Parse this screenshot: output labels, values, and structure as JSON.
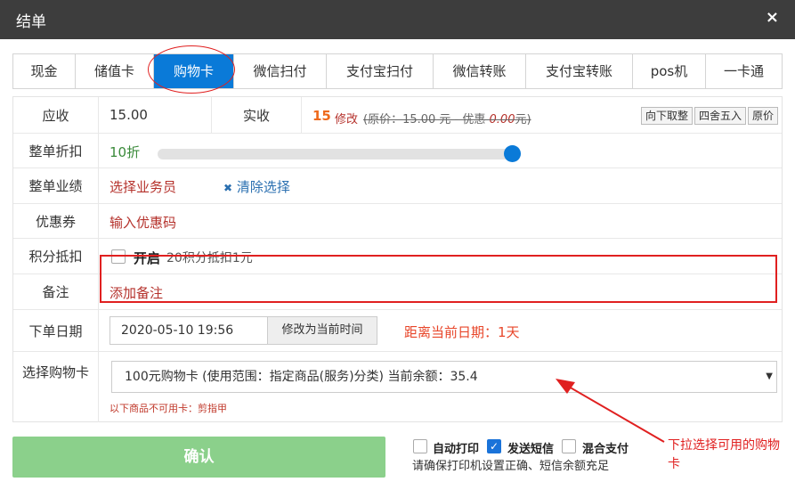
{
  "dialog": {
    "title": "结单",
    "close_icon": "×"
  },
  "tabs": [
    {
      "label": "现金",
      "active": false
    },
    {
      "label": "储值卡",
      "active": false
    },
    {
      "label": "购物卡",
      "active": true
    },
    {
      "label": "微信扫付",
      "active": false
    },
    {
      "label": "支付宝扫付",
      "active": false
    },
    {
      "label": "微信转账",
      "active": false
    },
    {
      "label": "支付宝转账",
      "active": false
    },
    {
      "label": "pos机",
      "active": false
    },
    {
      "label": "一卡通",
      "active": false
    }
  ],
  "receivable": {
    "label": "应收",
    "value": "15.00"
  },
  "actual": {
    "label": "实收",
    "value": "15",
    "modify": "修改",
    "detail": "(原价：15.00 元 - 优惠 ",
    "discount_value": "0.00",
    "detail_end": "元)",
    "round_down": "向下取整",
    "round_half": "四舍五入",
    "original": "原价"
  },
  "discount": {
    "label": "整单折扣",
    "value": "10折",
    "level": 1.0
  },
  "performance": {
    "label": "整单业绩",
    "select": "选择业务员",
    "clear": "清除选择",
    "clear_icon": "✖"
  },
  "coupon": {
    "label": "优惠券",
    "input": "输入优惠码"
  },
  "points": {
    "label": "积分抵扣",
    "toggle": "开启",
    "rule": "20积分抵扣1元",
    "checked": false
  },
  "remark": {
    "label": "备注",
    "add": "添加备注"
  },
  "order_date": {
    "label": "下单日期",
    "value": "2020-05-10 19:56",
    "set_now": "修改为当前时间",
    "distance": "距离当前日期：1天"
  },
  "shopping_card": {
    "label": "选择购物卡",
    "selected": "100元购物卡 (使用范围：指定商品(服务)分类)   当前余额：35.4",
    "unusable": "以下商品不可用卡：剪指甲"
  },
  "confirm_label": "确认",
  "options": {
    "auto_print": {
      "label": "自动打印",
      "checked": false
    },
    "send_sms": {
      "label": "发送短信",
      "checked": true
    },
    "mixed_pay": {
      "label": "混合支付",
      "checked": false
    },
    "hint": "请确保打印机设置正确、短信余额充足"
  },
  "annotation": "下拉选择可用的购物卡",
  "colors": {
    "accent": "#0a7ad8",
    "highlight": "#e02020",
    "confirm": "#8bd08b",
    "link": "#b5322c",
    "orange": "#ee6a1c"
  }
}
